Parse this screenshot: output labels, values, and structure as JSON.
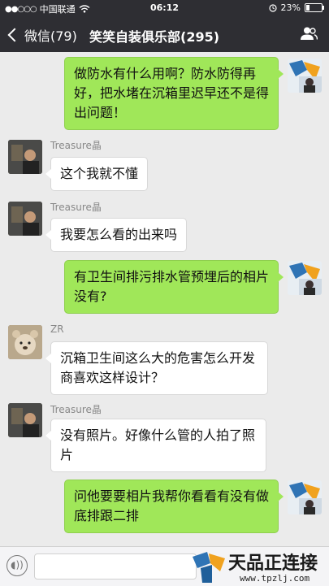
{
  "status_bar": {
    "carrier": "中国联通",
    "time": "06:12",
    "battery": "23%"
  },
  "nav": {
    "back_label": "微信(79)",
    "title": "笑笑自装俱乐部(295)",
    "members_icon": "people-icon"
  },
  "messages": [
    {
      "direction": "outgoing",
      "sender": "",
      "text": "做防水有什么用啊？防水防得再好，把水堵在沉箱里迟早还不是得出问题！"
    },
    {
      "direction": "incoming",
      "sender": "Treasure晶",
      "text": "这个我就不懂"
    },
    {
      "direction": "incoming",
      "sender": "Treasure晶",
      "text": "我要怎么看的出来吗"
    },
    {
      "direction": "outgoing",
      "sender": "",
      "text": "有卫生间排污排水管预埋后的相片没有?"
    },
    {
      "direction": "incoming",
      "sender": "ZR",
      "text": "沉箱卫生间这么大的危害怎么开发商喜欢这样设计？"
    },
    {
      "direction": "incoming",
      "sender": "Treasure晶",
      "text": "没有照片。好像什么管的人拍了照片"
    },
    {
      "direction": "outgoing",
      "sender": "",
      "text": "问他要要相片我帮你看看有没有做底排跟二排"
    }
  ],
  "input": {
    "voice_icon": "voice-icon",
    "value": ""
  },
  "watermark": {
    "text": "天品正连接",
    "url": "www.tpzlj.com"
  },
  "colors": {
    "header": "#2e2e33",
    "chat_background": "#ebebeb",
    "outgoing_bubble": "#a0e759",
    "incoming_bubble": "#ffffff"
  }
}
